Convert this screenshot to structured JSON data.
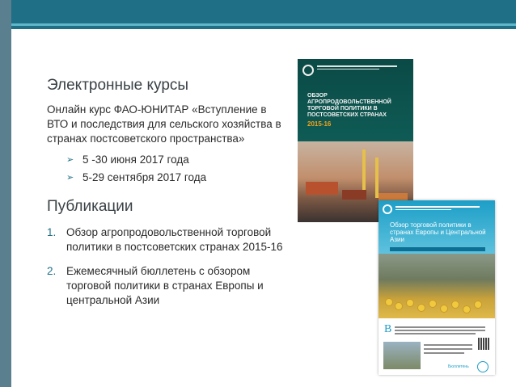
{
  "slide": {
    "courses_heading": "Электронные курсы",
    "course_description": "Онлайн курс ФАО-ЮНИТАР «Вступление в ВТО и последствия для сельского хозяйства в странах постсоветского пространства»",
    "course_dates": [
      "5 -30 июня 2017 года",
      "5-29 сентября 2017 года"
    ],
    "publications_heading": "Публикации",
    "publications": [
      {
        "number": "1.",
        "title": "Обзор агропродовольственной торговой политики в постсоветских странах 2015-16"
      },
      {
        "number": "2.",
        "title": "Ежемесячный бюллетень с обзором торговой политики в странах Европы и центральной Азии"
      }
    ]
  },
  "cover_review": {
    "title": "ОБЗОР АГРОПРОДОВОЛЬСТВЕННОЙ ТОРГОВОЙ ПОЛИТИКИ В ПОСТСОВЕТСКИХ СТРАНАХ",
    "year": "2015-16"
  },
  "cover_bulletin": {
    "title": "Обзор торговой политики в странах Европы и Центральной Азии",
    "dropcap": "В",
    "footer_label": "Бюллетень"
  },
  "colors": {
    "accent": "#1f6f86",
    "top_bar": "#1f6f86",
    "left_bar": "#5a7f8e",
    "cover_review_bg": "#0f4c47",
    "cover_bulletin_head": "#1d9ec7",
    "year_highlight": "#f2a21c"
  },
  "icons": {
    "bullet": "arrow-right-icon",
    "logo": "fao-logo-icon"
  }
}
